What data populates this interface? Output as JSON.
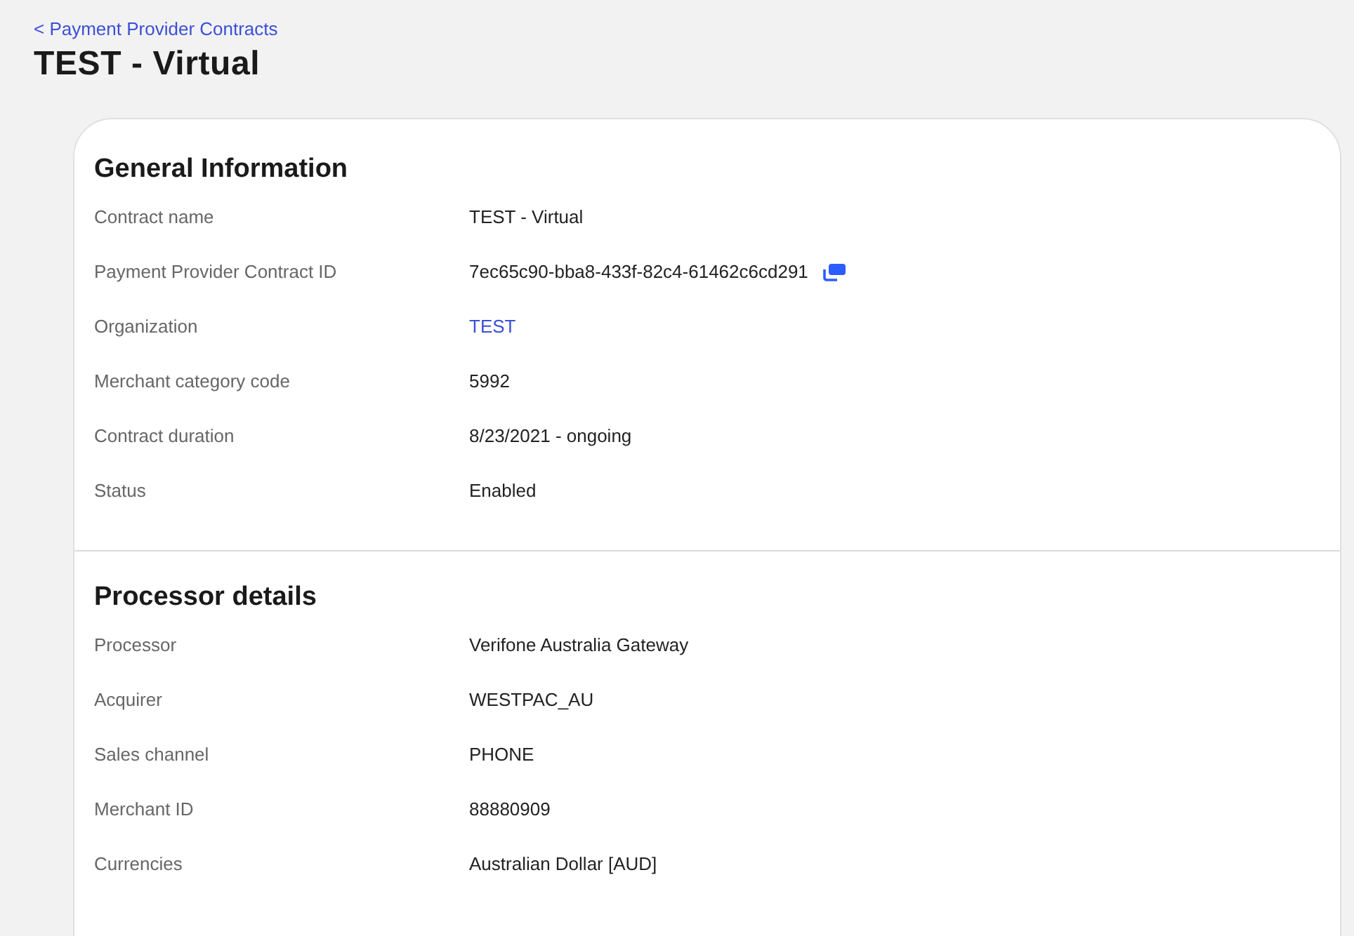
{
  "breadcrumb": {
    "label": "< Payment Provider Contracts"
  },
  "title": "TEST - Virtual",
  "sections": [
    {
      "title": "General Information",
      "rows": [
        {
          "label": "Contract name",
          "value": "TEST - Virtual",
          "kind": "text"
        },
        {
          "label": "Payment Provider Contract ID",
          "value": "7ec65c90-bba8-433f-82c4-61462c6cd291",
          "kind": "copyable"
        },
        {
          "label": "Organization",
          "value": "TEST",
          "kind": "link"
        },
        {
          "label": "Merchant category code",
          "value": "5992",
          "kind": "text"
        },
        {
          "label": "Contract duration",
          "value": "8/23/2021 - ongoing",
          "kind": "text"
        },
        {
          "label": "Status",
          "value": "Enabled",
          "kind": "text"
        }
      ]
    },
    {
      "title": "Processor details",
      "rows": [
        {
          "label": "Processor",
          "value": "Verifone Australia Gateway",
          "kind": "text"
        },
        {
          "label": "Acquirer",
          "value": "WESTPAC_AU",
          "kind": "text"
        },
        {
          "label": "Sales channel",
          "value": "PHONE",
          "kind": "text"
        },
        {
          "label": "Merchant ID",
          "value": "88880909",
          "kind": "text"
        },
        {
          "label": "Currencies",
          "value": "Australian Dollar [AUD]",
          "kind": "text"
        }
      ]
    }
  ]
}
